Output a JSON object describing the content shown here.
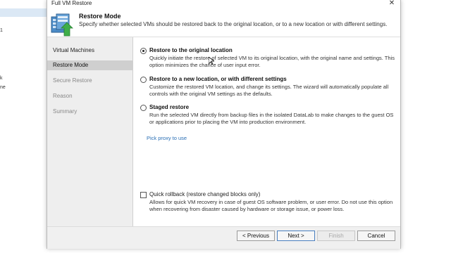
{
  "background": {
    "fragments": [
      "1",
      "k",
      "ne"
    ]
  },
  "window": {
    "title": "Full VM Restore",
    "close_glyph": "✕"
  },
  "header": {
    "title": "Restore Mode",
    "description": "Specify whether selected VMs should be restored back to the original location, or to a new location or with different settings."
  },
  "steps": [
    {
      "label": "Virtual Machines",
      "state": "done"
    },
    {
      "label": "Restore Mode",
      "state": "active"
    },
    {
      "label": "Secure Restore",
      "state": "pending"
    },
    {
      "label": "Reason",
      "state": "pending"
    },
    {
      "label": "Summary",
      "state": "pending"
    }
  ],
  "options": [
    {
      "label": "Restore to the original location",
      "description": "Quickly initiate the restore of selected VM to its original location, with the original name and settings. This option minimizes the chance of user input error.",
      "selected": true
    },
    {
      "label": "Restore to a new location, or with different settings",
      "description": "Customize the restored VM location, and change its settings. The wizard will automatically populate all controls with the original VM settings as the defaults.",
      "selected": false
    },
    {
      "label": "Staged restore",
      "description": "Run the selected VM directly from backup files in the isolated DataLab to make changes to the guest OS or applications prior to placing the VM into production environment.",
      "selected": false
    }
  ],
  "proxy_link": "Pick proxy to use",
  "quick_rollback": {
    "label": "Quick rollback (restore changed blocks only)",
    "description": "Allows for quick VM recovery in case of guest OS software problem, or user error. Do not use this option when recovering from disaster caused by hardware or storage issue, or power loss.",
    "checked": false
  },
  "buttons": {
    "previous": "< Previous",
    "next": "Next >",
    "finish": "Finish",
    "cancel": "Cancel"
  },
  "colors": {
    "sidebar_bg": "#eeeeee",
    "active_step_bg": "#cfcfcf",
    "link": "#2a6fb5",
    "icon_green": "#3fae49",
    "icon_blue": "#4c8cc8"
  }
}
